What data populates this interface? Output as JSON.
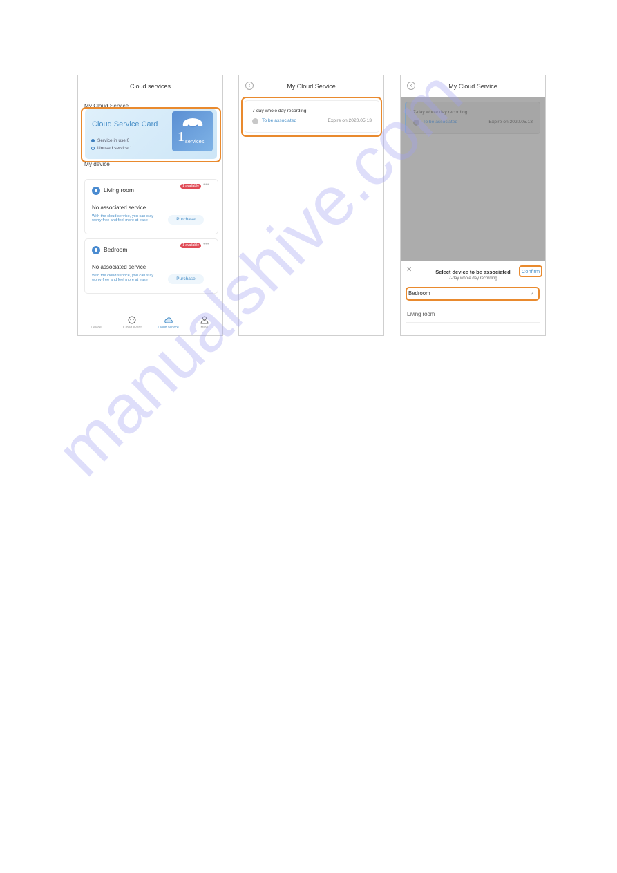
{
  "panel1": {
    "title": "Cloud services",
    "section_my_cloud": "My Cloud Service",
    "card": {
      "title": "Cloud Service Card",
      "in_use": "Service in use:0",
      "unused": "Unused service:1",
      "count": "1",
      "unit": "services"
    },
    "section_my_device": "My device",
    "devices": [
      {
        "name": "Living room",
        "badge": "1 available",
        "status": "No associated service",
        "desc": "With the cloud service, you can stay worry-free and feel more at ease",
        "action": "Purchase"
      },
      {
        "name": "Bedroom",
        "badge": "1 available",
        "status": "No associated service",
        "desc": "With the cloud service, you can stay worry-free and feel more at ease",
        "action": "Purchase"
      }
    ],
    "tabs": [
      {
        "label": "Device",
        "icon": "device-icon"
      },
      {
        "label": "Cloud event",
        "icon": "cloud-event-icon"
      },
      {
        "label": "Cloud service",
        "icon": "cloud-icon",
        "active": true
      },
      {
        "label": "Mine",
        "icon": "user-icon"
      }
    ]
  },
  "panel2": {
    "title": "My Cloud Service",
    "record": {
      "title": "7-day whole day recording",
      "status": "To be associated",
      "expire": "Expire on 2020.05.13"
    }
  },
  "panel3": {
    "title": "My Cloud Service",
    "record": {
      "title": "7-day whole day recording",
      "status": "To be associated",
      "expire": "Expire on 2020.05.13"
    },
    "sheet": {
      "title": "Select device to be associated",
      "subtitle": "7-day whole day recording",
      "confirm": "Confirm",
      "options": [
        {
          "label": "Bedroom",
          "selected": true
        },
        {
          "label": "Living room",
          "selected": false
        }
      ]
    }
  },
  "watermark": "manualshive.com",
  "colors": {
    "accent": "#4a90c8",
    "highlight": "#e98a2e",
    "badge": "#e04a55"
  }
}
